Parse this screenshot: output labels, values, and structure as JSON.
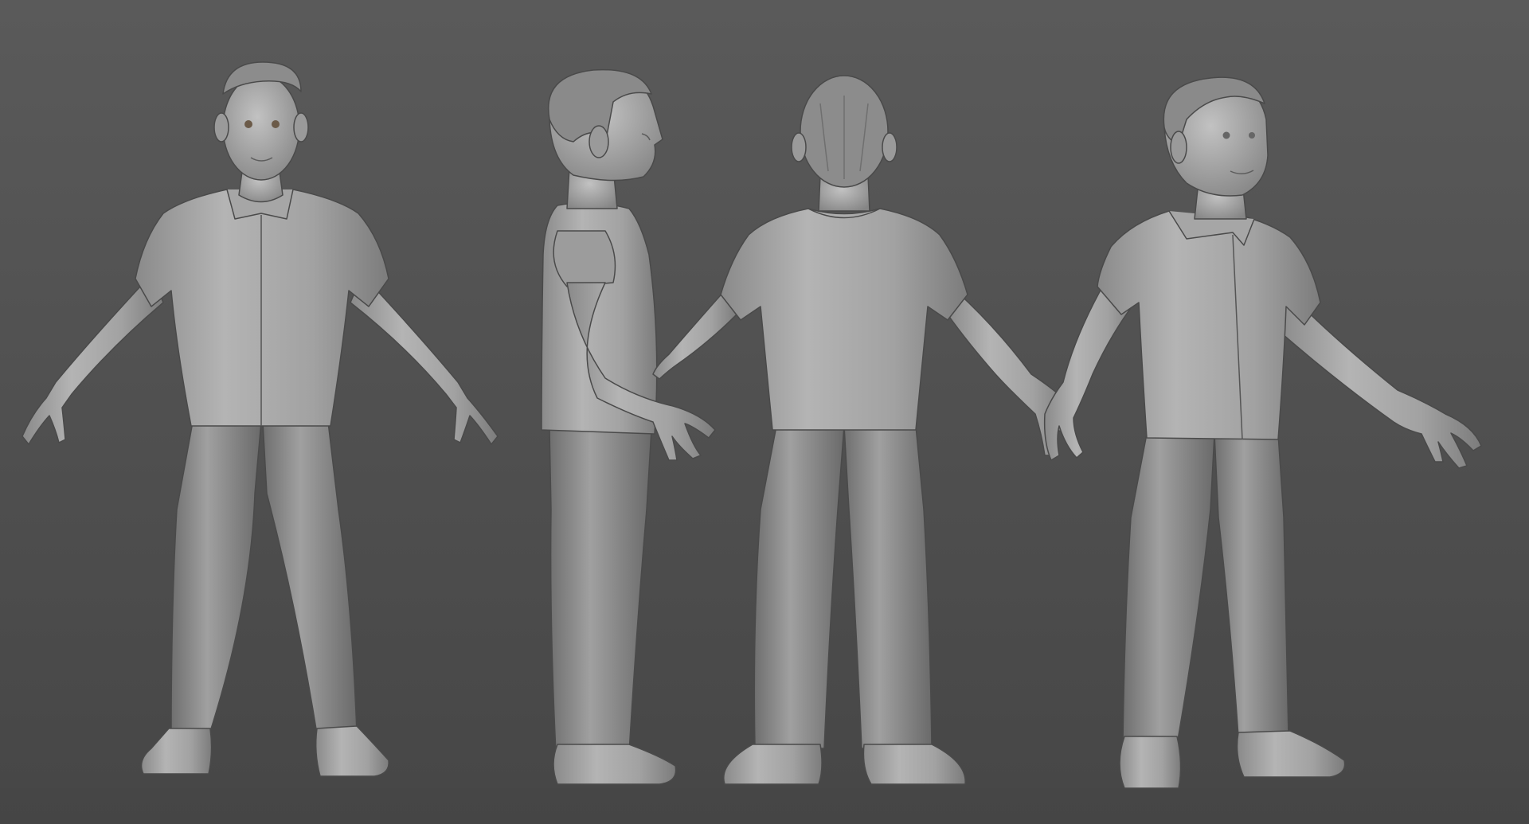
{
  "scene": {
    "background_top": "#595959",
    "background_bottom": "#474747",
    "clay_color": "#a8a8a8",
    "views": [
      {
        "view": "front",
        "icon": "character-front-view"
      },
      {
        "view": "side",
        "icon": "character-side-view"
      },
      {
        "view": "back",
        "icon": "character-back-view"
      },
      {
        "view": "three-quarter",
        "icon": "character-three-quarter-view"
      }
    ]
  }
}
